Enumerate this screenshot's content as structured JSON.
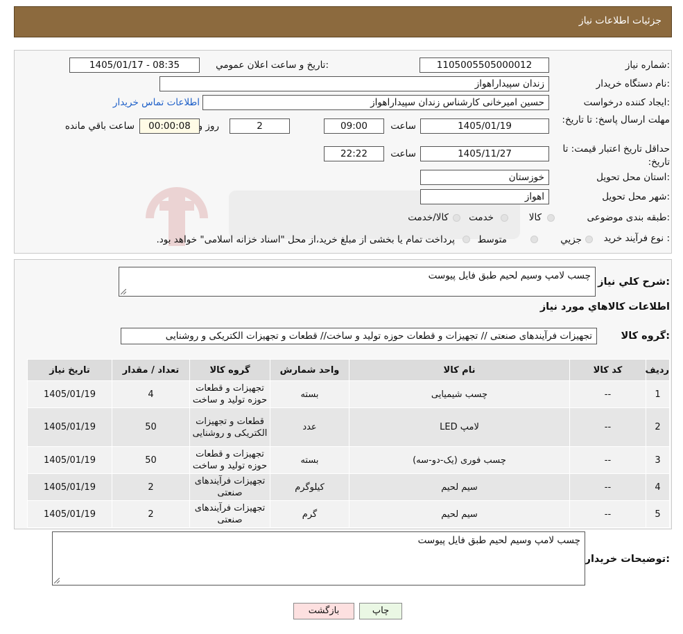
{
  "header": {
    "title": "جزئیات اطلاعات نیاز"
  },
  "form": {
    "need_number_label": "شماره نیاز:",
    "need_number": "1105005505000012",
    "announce_label": "تاریخ و ساعت اعلان عمومي:",
    "announce_value": "1405/01/17 - 08:35",
    "buyer_org_label": "نام دستگاه خریدار:",
    "buyer_org": "زندان سپیداراهواز",
    "creator_label": "ایجاد کننده درخواست:",
    "creator": "حسین امیرخانی کارشناس زندان سپیداراهواز",
    "contact_link": "اطلاعات تماس خریدار",
    "reply_deadline_label": "مهلت ارسال پاسخ: تا تاریخ:",
    "reply_date": "1405/01/19",
    "time_label": "ساعت",
    "reply_time": "09:00",
    "days_value": "2",
    "days_label": "روز و",
    "remaining_value": "00:00:08",
    "remaining_label": "ساعت باقي مانده",
    "price_valid_label": "حداقل تاریخ اعتبار قیمت: تا تاریخ:",
    "price_valid_date": "1405/11/27",
    "price_valid_time": "22:22",
    "province_label": "استان محل تحویل:",
    "province": "خوزستان",
    "city_label": "شهر محل تحویل:",
    "city": "اهواز",
    "category_label": "طبقه بندی موضوعی:",
    "category_options": [
      "کالا",
      "خدمت",
      "کالا/خدمت"
    ],
    "process_label": "نوع فرآیند خرید :",
    "process_options": [
      "جزیي",
      "متوسط"
    ],
    "process_note": "پرداخت تمام یا بخشی از مبلغ خرید،از محل \"اسناد خزانه اسلامی\" خواهد بود."
  },
  "details": {
    "summary_label": "شرح کلي نیاز:",
    "summary": "چسب لامپ وسیم لحیم طبق فایل پیوست",
    "goods_info_title": "اطلاعات کالاهاي مورد نیاز",
    "group_label": "گروه کالا:",
    "group_value": "تجهیزات فرآیندهای صنعتی // تجهیزات و قطعات حوزه تولید و ساخت// قطعات و تجهیزات الکتریکی و روشنایی"
  },
  "table": {
    "headers": [
      "ردیف",
      "کد کالا",
      "نام کالا",
      "واحد شمارش",
      "گروه کالا",
      "تعداد / مقدار",
      "تاریخ نیاز"
    ],
    "rows": [
      [
        "1",
        "--",
        "چسب شیمیایی",
        "بسته",
        "تجهیزات و قطعات حوزه تولید و ساخت",
        "4",
        "1405/01/19"
      ],
      [
        "2",
        "--",
        "لامپ LED",
        "عدد",
        "قطعات و تجهیزات الکتریکی و روشنایی",
        "50",
        "1405/01/19"
      ],
      [
        "3",
        "--",
        "چسب فوری (یک-دو-سه)",
        "بسته",
        "تجهیزات و قطعات حوزه تولید و ساخت",
        "50",
        "1405/01/19"
      ],
      [
        "4",
        "--",
        "سیم لحیم",
        "کیلوگرم",
        "تجهیزات فرآیندهای صنعتی",
        "2",
        "1405/01/19"
      ],
      [
        "5",
        "--",
        "سیم لحیم",
        "گرم",
        "تجهیزات فرآیندهای صنعتی",
        "2",
        "1405/01/19"
      ]
    ]
  },
  "buyer_notes": {
    "label": "توضیحات خریدار:",
    "text": "چسب لامپ وسیم لحیم طبق فایل پیوست"
  },
  "buttons": {
    "print": "چاپ",
    "back": "بازگشت"
  },
  "colors": {
    "header_bg": "#8c6a3e",
    "link": "#1d5fc8",
    "back_button_bg": "#fde0e0",
    "print_button_bg": "#eaf7e4"
  }
}
